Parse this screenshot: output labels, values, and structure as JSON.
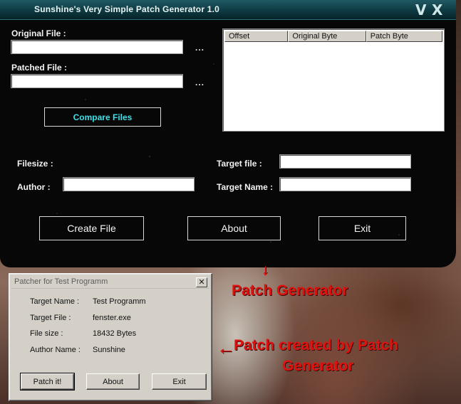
{
  "generator": {
    "title": "Sunshine's Very Simple Patch Generator 1.0",
    "minimize_label": "V",
    "close_label": "X",
    "original_file_label": "Original File :",
    "original_file_value": "",
    "patched_file_label": "Patched File :",
    "patched_file_value": "",
    "browse_label": "...",
    "compare_button": "Compare Files",
    "list_columns": [
      "Offset",
      "Original Byte",
      "Patch Byte"
    ],
    "filesize_label": "Filesize :",
    "filesize_value": "",
    "author_label": "Author :",
    "author_value": "",
    "target_file_label": "Target file :",
    "target_file_value": "",
    "target_name_label": "Target Name :",
    "target_name_value": "",
    "create_button": "Create File",
    "about_button": "About",
    "exit_button": "Exit"
  },
  "annotations": {
    "arrow_top": "←",
    "generator_caption": "Patch Generator",
    "arrow_left": "←",
    "patch_caption_line1": "Patch created by Patch",
    "patch_caption_line2": "Generator"
  },
  "patcher": {
    "title": "Patcher for Test Programm",
    "close_label": "✕",
    "rows": [
      {
        "label": "Target Name :",
        "value": "Test Programm"
      },
      {
        "label": "Target File :",
        "value": "fenster.exe"
      },
      {
        "label": "File size :",
        "value": "18432 Bytes"
      },
      {
        "label": "Author Name :",
        "value": "Sunshine"
      }
    ],
    "patch_button": "Patch it!",
    "about_button": "About",
    "exit_button": "Exit"
  },
  "colors": {
    "title_bar": "#0e3a42",
    "compare_text": "#3fe0ea",
    "annotation_red": "#e0120e",
    "dialog_face": "#d4d0c8"
  }
}
